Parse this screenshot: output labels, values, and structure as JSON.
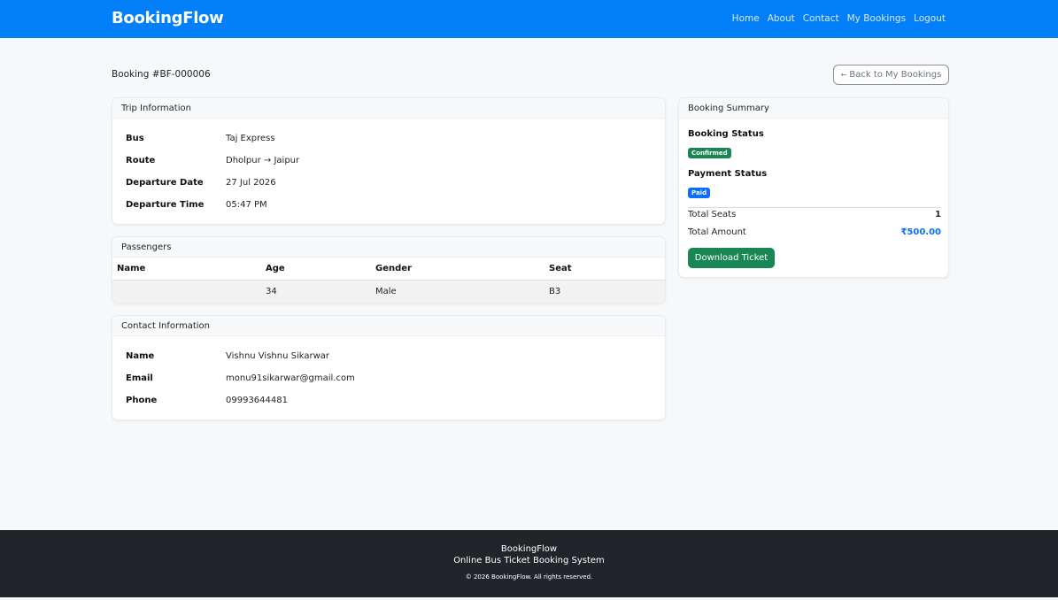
{
  "nav": {
    "brand": "BookingFlow",
    "links": [
      "Home",
      "About",
      "Contact",
      "My Bookings",
      "Logout"
    ]
  },
  "header": {
    "booking_title": "Booking #BF-000006",
    "back_label": "Back to My Bookings",
    "back_arrow": "←"
  },
  "trip": {
    "title": "Trip Information",
    "rows": [
      {
        "label": "Bus",
        "value": "Taj Express"
      },
      {
        "label": "Route",
        "value": "Dholpur → Jaipur"
      },
      {
        "label": "Departure Date",
        "value": "27 Jul 2026"
      },
      {
        "label": "Departure Time",
        "value": "05:47 PM"
      }
    ]
  },
  "passengers": {
    "title": "Passengers",
    "columns": [
      "Name",
      "Age",
      "Gender",
      "Seat"
    ],
    "rows": [
      {
        "name": "",
        "age": "34",
        "gender": "Male",
        "seat": "B3"
      }
    ]
  },
  "contact": {
    "title": "Contact Information",
    "rows": [
      {
        "label": "Name",
        "value": "Vishnu Vishnu Sikarwar"
      },
      {
        "label": "Email",
        "value": "monu91sikarwar@gmail.com"
      },
      {
        "label": "Phone",
        "value": "09993644481"
      }
    ]
  },
  "summary": {
    "title": "Booking Summary",
    "booking_status_label": "Booking Status",
    "booking_status": "Confirmed",
    "payment_status_label": "Payment Status",
    "payment_status": "Paid",
    "total_seats_label": "Total Seats",
    "total_seats": "1",
    "total_amount_label": "Total Amount",
    "total_amount": "₹500.00",
    "download_label": "Download Ticket"
  },
  "footer": {
    "brand": "BookingFlow",
    "tagline": "Online Bus Ticket Booking System",
    "copyright": "© 2026 BookingFlow. All rights reserved."
  },
  "colors": {
    "primary": "#0380f8",
    "success": "#198754",
    "badge_primary": "#0d6efd",
    "footer_bg": "#212529"
  }
}
